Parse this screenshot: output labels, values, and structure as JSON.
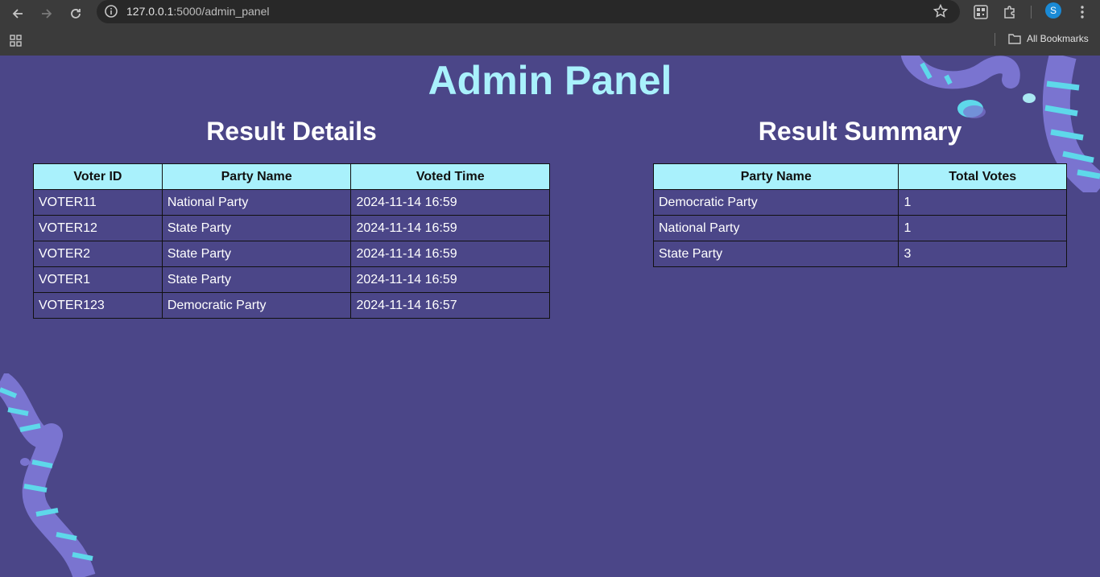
{
  "browser": {
    "url_host": "127.0.0.1",
    "url_path": ":5000/admin_panel",
    "avatar_letter": "S",
    "bookmarks_label": "All Bookmarks"
  },
  "page": {
    "title": "Admin Panel",
    "colors": {
      "background": "#4b4688",
      "accent": "#a9f1fc"
    }
  },
  "details": {
    "title": "Result Details",
    "columns": [
      "Voter ID",
      "Party Name",
      "Voted Time"
    ],
    "rows": [
      [
        "VOTER11",
        "National Party",
        "2024-11-14 16:59"
      ],
      [
        "VOTER12",
        "State Party",
        "2024-11-14 16:59"
      ],
      [
        "VOTER2",
        "State Party",
        "2024-11-14 16:59"
      ],
      [
        "VOTER1",
        "State Party",
        "2024-11-14 16:59"
      ],
      [
        "VOTER123",
        "Democratic Party",
        "2024-11-14 16:57"
      ]
    ]
  },
  "summary": {
    "title": "Result Summary",
    "columns": [
      "Party Name",
      "Total Votes"
    ],
    "rows": [
      [
        "Democratic Party",
        "1"
      ],
      [
        "National Party",
        "1"
      ],
      [
        "State Party",
        "3"
      ]
    ]
  }
}
